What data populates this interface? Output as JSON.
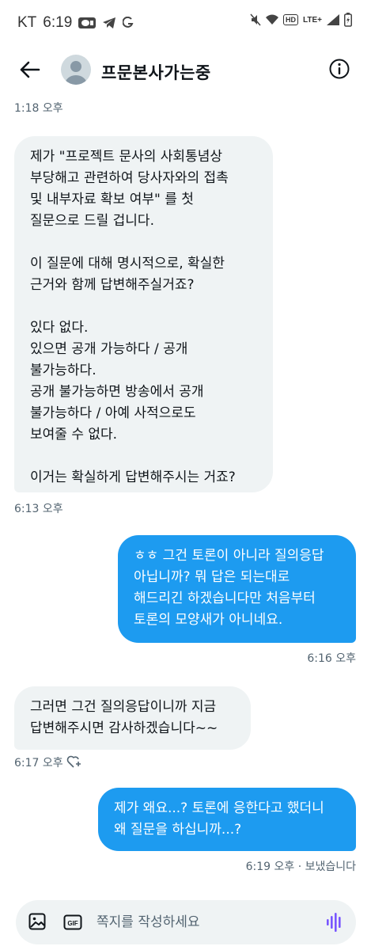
{
  "status_bar": {
    "carrier": "KT",
    "time": "6:19",
    "hd_label": "HD",
    "network_label": "LTE+"
  },
  "header": {
    "title": "프문본사가는중"
  },
  "messages": [
    {
      "side": "left",
      "text": "제가 \"프로젝트 문사의 사회통념상\n부당해고 관련하여 당사자와의 접촉\n및 내부자료 확보 여부\" 를 첫\n질문으로 드릴 겁니다.\n\n이 질문에 대해 명시적으로, 확실한\n근거와 함께 답변해주실거죠?\n\n있다 없다.\n있으면 공개 가능하다 / 공개\n불가능하다.\n공개 불가능하면 방송에서 공개\n불가능하다 / 아예 사적으로도\n보여줄 수 없다.\n\n이거는 확실하게 답변해주시는 거죠?",
      "time": "6:13 오후"
    },
    {
      "side": "right",
      "text": "ㅎㅎ 그건 토론이 아니라 질의응답\n아닙니까? 뭐 답은 되는대로\n해드리긴 하겠습니다만 처음부터\n토론의 모양새가 아니네요.",
      "time": "6:16 오후"
    },
    {
      "side": "left",
      "text": "그러면 그건 질의응답이니까 지금\n답변해주시면 감사하겠습니다~~",
      "time": "6:17 오후"
    },
    {
      "side": "right",
      "text": "제가 왜요...? 토론에 응한다고 했더니\n왜 질문을 하십니까...?",
      "time": "6:19 오후 · 보냈습니다"
    }
  ],
  "earlier_timestamp": "1:18 오후",
  "composer": {
    "placeholder": "쪽지를 작성하세요"
  },
  "colors": {
    "accent": "#1d9bf0",
    "received_bubble": "#eff3f4",
    "muted_text": "#536471"
  }
}
